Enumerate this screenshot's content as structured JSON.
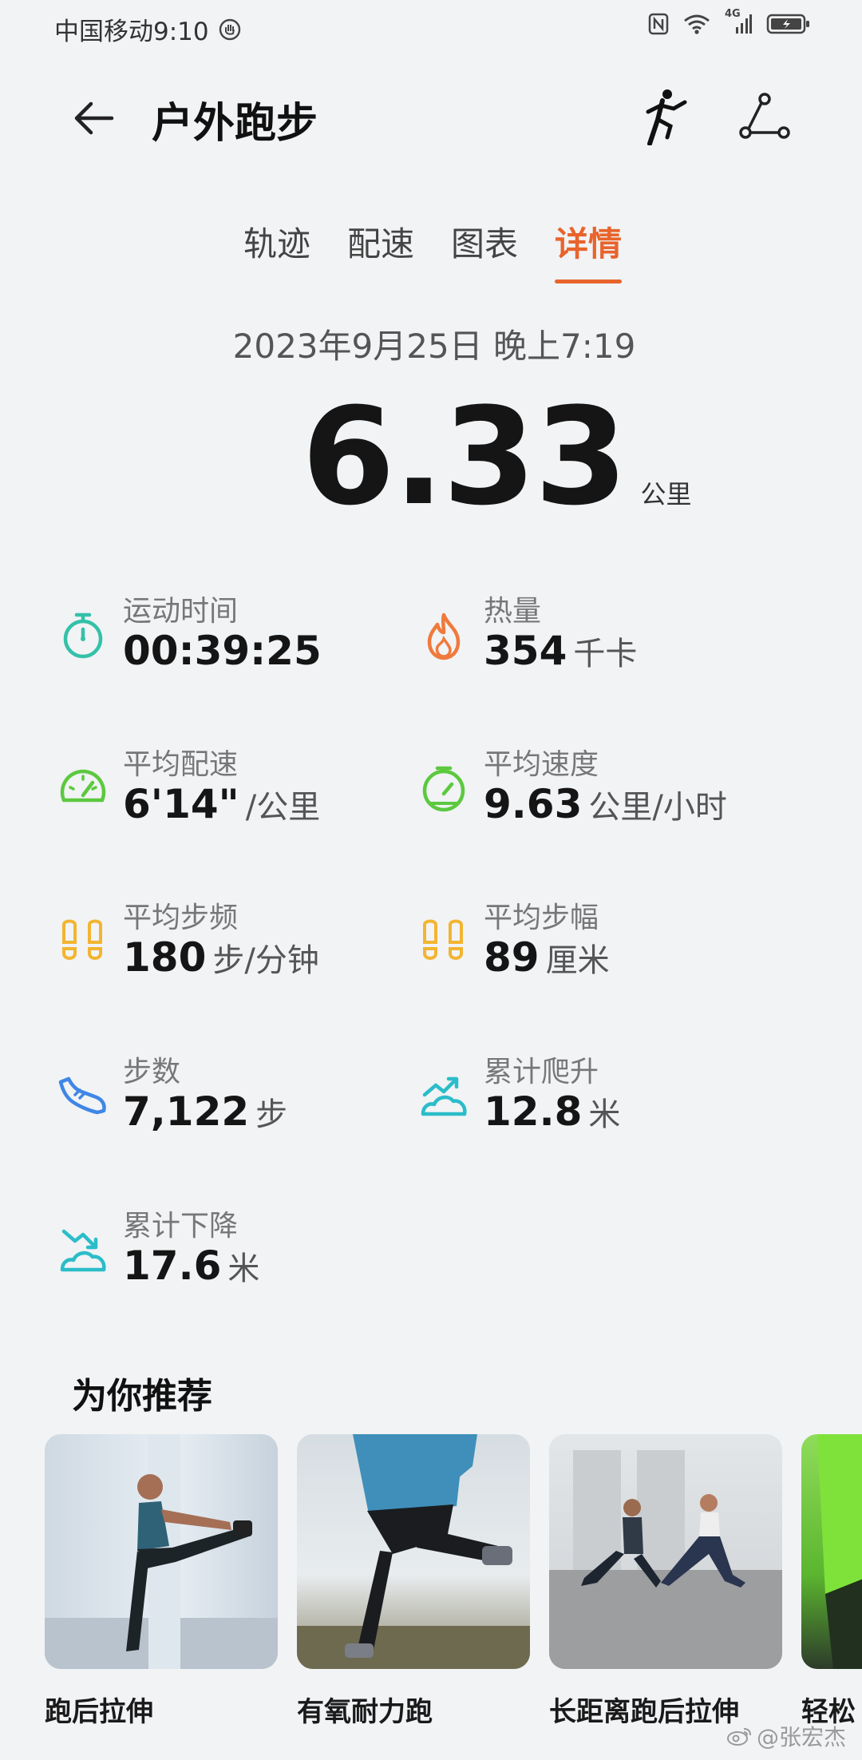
{
  "status_bar": {
    "carrier_time": "中国移动9:10",
    "network": "4G",
    "icons": [
      "hand-icon",
      "nfc-icon",
      "wifi-icon",
      "signal-icon",
      "battery-icon"
    ]
  },
  "header": {
    "title": "户外跑步",
    "icons": [
      "back-arrow-icon",
      "runner-icon",
      "route-share-icon"
    ]
  },
  "tabs": [
    {
      "label": "轨迹",
      "active": false
    },
    {
      "label": "配速",
      "active": false
    },
    {
      "label": "图表",
      "active": false
    },
    {
      "label": "详情",
      "active": true
    }
  ],
  "summary": {
    "datetime": "2023年9月25日 晚上7:19",
    "distance": "6.33",
    "distance_unit": "公里"
  },
  "stats": [
    {
      "label": "运动时间",
      "value": "00:39:25",
      "unit": "",
      "icon": "stopwatch-icon",
      "color": "#33c1a8"
    },
    {
      "label": "热量",
      "value": "354",
      "unit": "千卡",
      "icon": "flame-icon",
      "color": "#ef7a3c"
    },
    {
      "label": "平均配速",
      "value": "6'14\"",
      "unit": "/公里",
      "icon": "speedometer-icon",
      "color": "#5cc93f"
    },
    {
      "label": "平均速度",
      "value": "9.63",
      "unit": "公里/小时",
      "icon": "speedometer-icon",
      "color": "#5cc93f"
    },
    {
      "label": "平均步频",
      "value": "180",
      "unit": "步/分钟",
      "icon": "footprints-icon",
      "color": "#f2b531"
    },
    {
      "label": "平均步幅",
      "value": "89",
      "unit": "厘米",
      "icon": "footprints-icon",
      "color": "#f2b531"
    },
    {
      "label": "步数",
      "value": "7,122",
      "unit": "步",
      "icon": "shoe-icon",
      "color": "#3f86e6"
    },
    {
      "label": "累计爬升",
      "value": "12.8",
      "unit": "米",
      "icon": "climb-icon",
      "color": "#2bbdc9"
    },
    {
      "label": "累计下降",
      "value": "17.6",
      "unit": "米",
      "icon": "descent-icon",
      "color": "#2bbdc9"
    }
  ],
  "recommendations": {
    "title": "为你推荐",
    "items": [
      {
        "label": "跑后拉伸"
      },
      {
        "label": "有氧耐力跑"
      },
      {
        "label": "长距离跑后拉伸"
      },
      {
        "label": "轻松"
      }
    ]
  },
  "watermark": "@张宏杰",
  "colors": {
    "accent": "#e8642c",
    "background": "#f1f3f5"
  }
}
